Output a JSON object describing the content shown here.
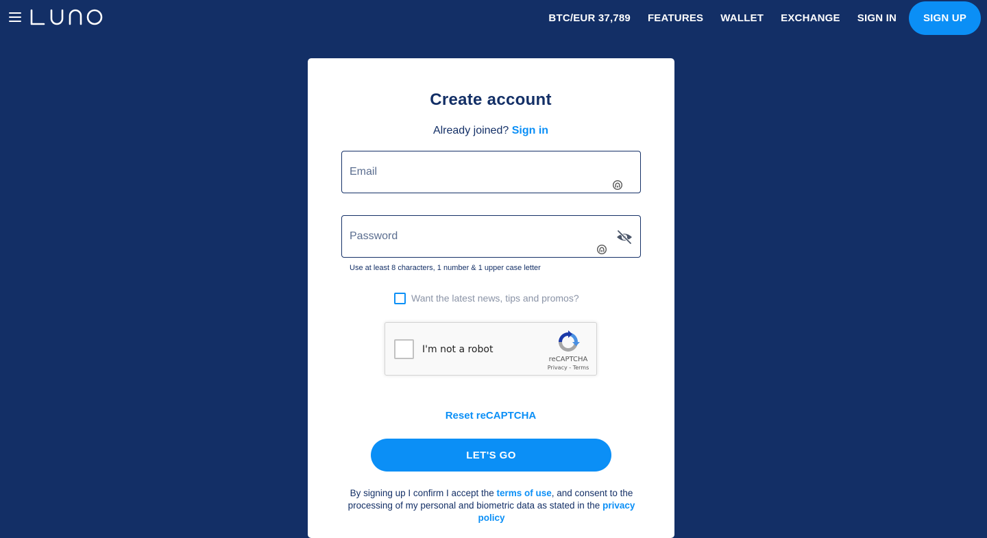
{
  "nav": {
    "menu_icon": "hamburger-menu-icon",
    "logo_text": "LUNO",
    "ticker": "BTC/EUR 37,789",
    "links": [
      "FEATURES",
      "WALLET",
      "EXCHANGE",
      "SIGN IN"
    ],
    "signup_label": "SIGN UP"
  },
  "form": {
    "title": "Create account",
    "already_text": "Already joined?",
    "signin_link": "Sign in",
    "email_placeholder": "Email",
    "password_placeholder": "Password",
    "password_hint": "Use at least 8 characters, 1 number & 1 upper case letter",
    "promo_label": "Want the latest news, tips and promos?",
    "reset_captcha": "Reset reCAPTCHA",
    "submit_label": "LET'S GO",
    "legal": {
      "part1": "By signing up I confirm I accept the",
      "terms_link": "terms of use",
      "part2": ", and consent to the processing of my personal and biometric data as stated in the",
      "privacy_link": "privacy policy"
    }
  },
  "recaptcha": {
    "label": "I'm not a robot",
    "brand": "reCAPTCHA",
    "privacy": "Privacy",
    "separator": " - ",
    "terms": "Terms"
  },
  "colors": {
    "background": "#132F66",
    "accent": "#0B8FF6",
    "card": "#FFFFFF",
    "text_dark": "#132F66"
  }
}
